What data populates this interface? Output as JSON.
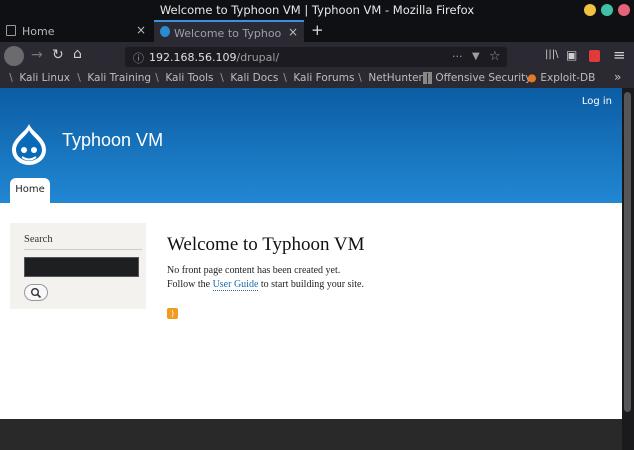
{
  "window": {
    "title": "Welcome to Typhoon VM | Typhoon VM - Mozilla Firefox",
    "colors": {
      "min": "#f0c240",
      "max": "#40c0a8",
      "close": "#e5647a"
    }
  },
  "tabs": [
    {
      "label": "Home",
      "close": "×"
    },
    {
      "label": "Welcome to Typhoon VM",
      "close": "×"
    }
  ],
  "newtab": "+",
  "nav": {
    "back": "←",
    "forward": "→",
    "reload": "↻",
    "home": "⌂",
    "url_host": "192.168.56.109",
    "url_path": "/drupal/",
    "url_info": "ⓘ",
    "page_actions": "···",
    "pocket": "▼",
    "bookmark_star": "☆",
    "library": "|||\\",
    "sidebar": "▣",
    "menu": "≡"
  },
  "bookmarks": [
    {
      "label": "Kali Linux",
      "icon": "dragon-icon"
    },
    {
      "label": "Kali Training",
      "icon": "dragon-icon"
    },
    {
      "label": "Kali Tools",
      "icon": "dragon-icon"
    },
    {
      "label": "Kali Docs",
      "icon": "dragon-icon"
    },
    {
      "label": "Kali Forums",
      "icon": "dragon-icon"
    },
    {
      "label": "NetHunter",
      "icon": "dragon-icon"
    },
    {
      "label": "Offensive Security",
      "icon": "offsec-icon"
    },
    {
      "label": "Exploit-DB",
      "icon": "exploitdb-icon"
    }
  ],
  "bookmarks_more": "»",
  "site": {
    "login": "Log in",
    "name": "Typhoon VM",
    "home_tab": "Home",
    "brand_blue": "#0b5da3",
    "search_title": "Search",
    "search_button": "🔍",
    "welcome_title": "Welcome to Typhoon VM",
    "line1": "No front page content has been created yet.",
    "line2_pre": "Follow the ",
    "line2_link": "User Guide",
    "line2_post": " to start building your site.",
    "feed_icon": "rss-icon"
  }
}
